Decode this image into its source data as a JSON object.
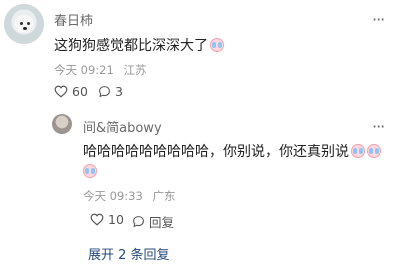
{
  "comment": {
    "author": "春日柿",
    "text": "这狗狗感觉都比深深大了",
    "emoji": "crying-face-emoji",
    "time": "今天 09:21",
    "location": "江苏",
    "likes": "60",
    "replies_count": "3",
    "more": "···"
  },
  "reply": {
    "author": "间&简abowy",
    "text": "哈哈哈哈哈哈哈哈哈，你别说，你还真别说",
    "emoji": "crying-face-emoji",
    "time": "今天 09:33",
    "location": "广东",
    "likes": "10",
    "reply_label": "回复",
    "more": "···"
  },
  "expand_label": "展开 2 条回复",
  "colors": {
    "link": "#274b7a",
    "muted": "#999999"
  }
}
